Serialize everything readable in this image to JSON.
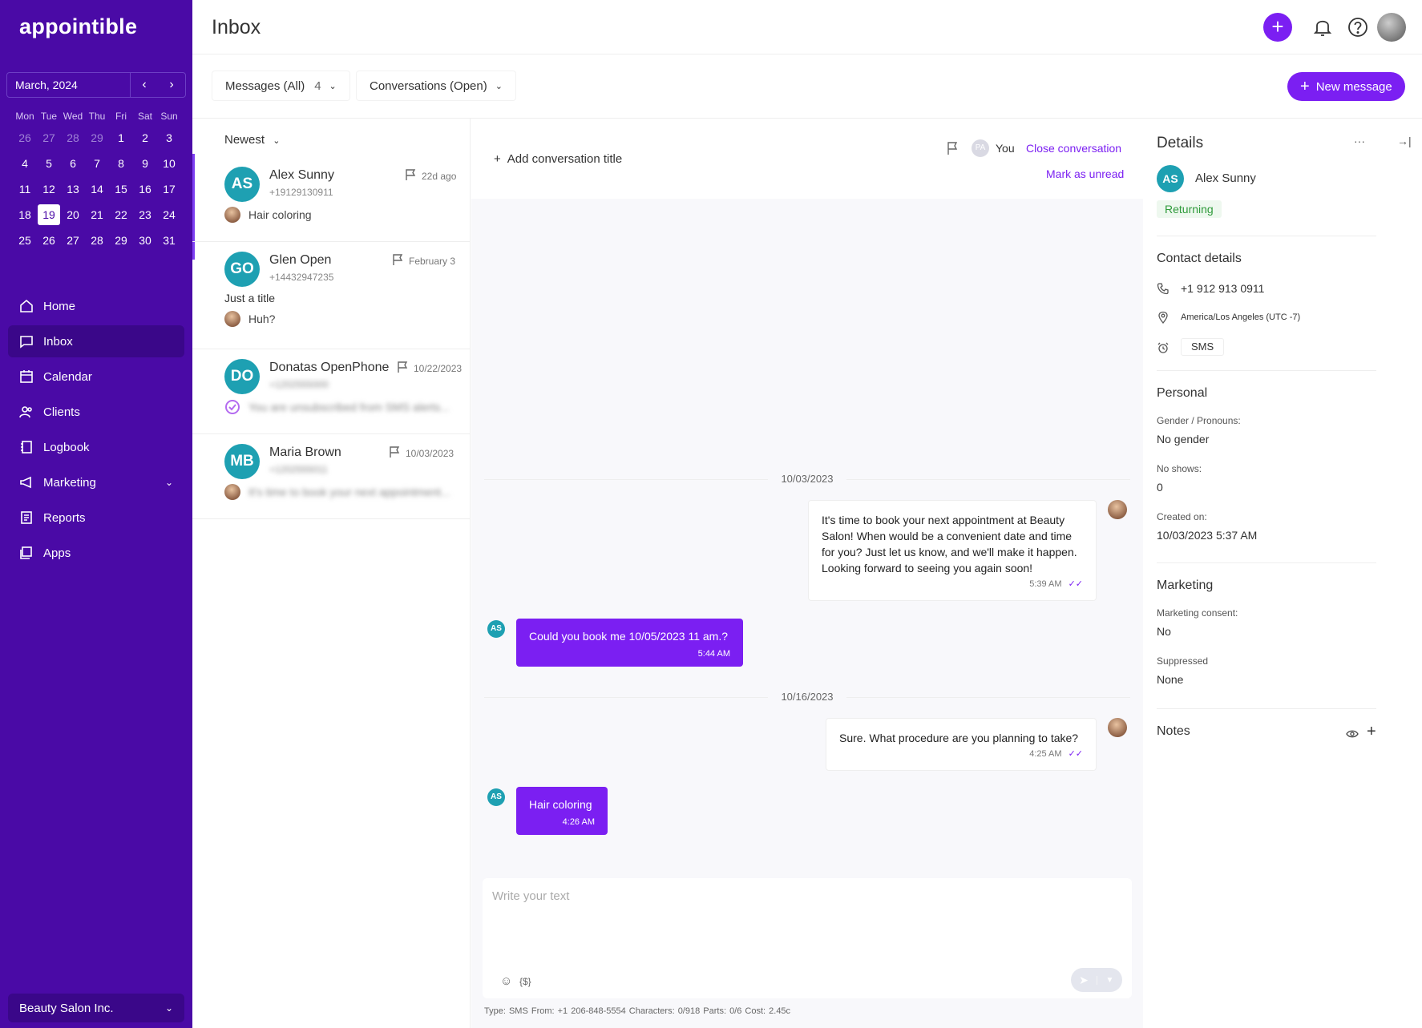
{
  "sidebar": {
    "logo": "appointible",
    "calendar": {
      "month_label": "March, 2024",
      "prev": "‹",
      "next": "›",
      "dow": [
        "Mon",
        "Tue",
        "Wed",
        "Thu",
        "Fri",
        "Sat",
        "Sun"
      ],
      "weeks": [
        [
          "26",
          "27",
          "28",
          "29",
          "1",
          "2",
          "3"
        ],
        [
          "4",
          "5",
          "6",
          "7",
          "8",
          "9",
          "10"
        ],
        [
          "11",
          "12",
          "13",
          "14",
          "15",
          "16",
          "17"
        ],
        [
          "18",
          "19",
          "20",
          "21",
          "22",
          "23",
          "24"
        ],
        [
          "25",
          "26",
          "27",
          "28",
          "29",
          "30",
          "31"
        ]
      ],
      "today": "19"
    },
    "nav": [
      {
        "label": "Home",
        "icon": "home-icon"
      },
      {
        "label": "Inbox",
        "icon": "inbox-icon",
        "active": true
      },
      {
        "label": "Calendar",
        "icon": "calendar-icon"
      },
      {
        "label": "Clients",
        "icon": "clients-icon"
      },
      {
        "label": "Logbook",
        "icon": "logbook-icon"
      },
      {
        "label": "Marketing",
        "icon": "megaphone-icon",
        "expandable": true
      },
      {
        "label": "Reports",
        "icon": "reports-icon"
      },
      {
        "label": "Apps",
        "icon": "apps-icon"
      }
    ],
    "org_name": "Beauty Salon Inc."
  },
  "header": {
    "title": "Inbox"
  },
  "filters": {
    "messages_label": "Messages (All)",
    "messages_count": "4",
    "conversations_label": "Conversations (Open)",
    "new_message": "New message"
  },
  "list": {
    "sort_label": "Newest",
    "conversations": [
      {
        "initials": "AS",
        "name": "Alex Sunny",
        "phone": "+19129130911",
        "date": "22d ago",
        "preview": "Hair coloring"
      },
      {
        "initials": "GO",
        "name": "Glen Open",
        "phone": "+14432947235",
        "date": "February 3",
        "title": "Just a title",
        "preview": "Huh?"
      },
      {
        "initials": "DO",
        "name": "Donatas OpenPhone",
        "phone": "+1202555000",
        "date": "10/22/2023",
        "preview": "You are unsubscribed from SMS alerts..."
      },
      {
        "initials": "MB",
        "name": "Maria Brown",
        "phone": "+1202555011",
        "date": "10/03/2023",
        "preview": "It's time to book your next appointment..."
      }
    ]
  },
  "chat": {
    "add_title": "Add conversation title",
    "assignee_initials": "PA",
    "assignee_label": "You",
    "close_label": "Close conversation",
    "mark_unread": "Mark as unread",
    "date1": "10/03/2023",
    "date2": "10/16/2023",
    "messages": [
      {
        "dir": "out",
        "text": "It's time to book your next appointment at Beauty Salon! When would be a convenient date and time for you? Just let us know, and we'll make it happen. Looking forward to seeing you again soon!",
        "time": "5:39 AM"
      },
      {
        "dir": "in",
        "initials": "AS",
        "text": "Could you book me 10/05/2023 11 am.?",
        "time": "5:44 AM"
      },
      {
        "dir": "out",
        "text": "Sure. What procedure are you planning to take?",
        "time": "4:25 AM"
      },
      {
        "dir": "in",
        "initials": "AS",
        "text": "Hair coloring",
        "time": "4:26 AM"
      }
    ],
    "composer_placeholder": "Write your text",
    "var_token": "{$}",
    "meta": "Type: SMS   From: +1 206-848-5554   Characters: 0/918   Parts: 0/6   Cost: 2.45c"
  },
  "details": {
    "title": "Details",
    "more": "···",
    "collapse": "→|",
    "initials": "AS",
    "name": "Alex Sunny",
    "badge": "Returning",
    "contact_title": "Contact details",
    "phone": "+1 912 913 0911",
    "timezone": "America/Los Angeles (UTC -7)",
    "channel": "SMS",
    "personal_title": "Personal",
    "gender_label": "Gender / Pronouns:",
    "gender_value": "No gender",
    "noshows_label": "No shows:",
    "noshows_value": "0",
    "created_label": "Created on:",
    "created_value": "10/03/2023 5:37 AM",
    "marketing_title": "Marketing",
    "consent_label": "Marketing consent:",
    "consent_value": "No",
    "suppressed_label": "Suppressed",
    "suppressed_value": "None",
    "notes_title": "Notes"
  },
  "colors": {
    "brand": "#4a0aa6",
    "accent": "#7b1ff2",
    "avatar": "#1ea0b2",
    "success": "#2e9a3a"
  }
}
